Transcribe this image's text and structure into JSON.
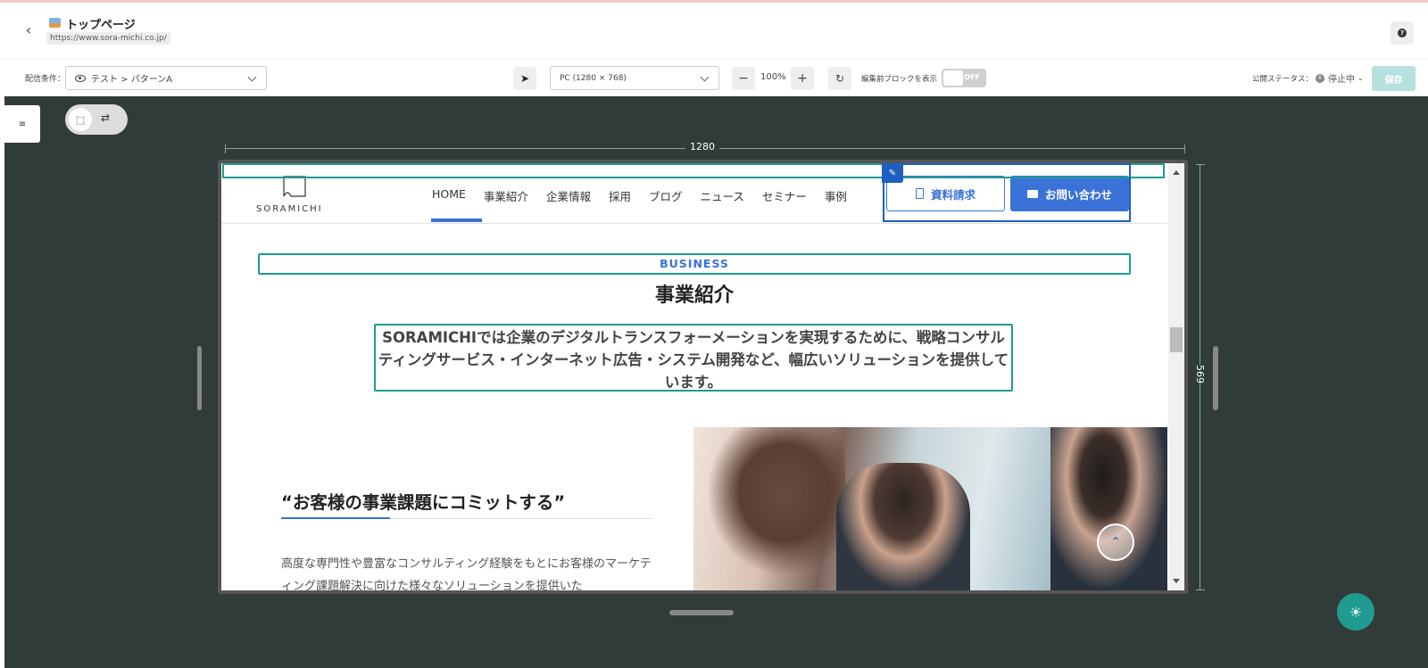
{
  "header": {
    "title": "トップページ",
    "url": "https://www.sora-michi.co.jp/"
  },
  "toolbar": {
    "condition_label": "配信条件：",
    "condition_value": "テスト > パターンA",
    "device": "PC (1280 × 768)",
    "zoom": "100%",
    "show_blocks_label": "編集前ブロックを表示",
    "toggle_state": "OFF",
    "status_label": "公開ステータス：",
    "status_value": "停止中",
    "save_label": "保存"
  },
  "canvas": {
    "width_label": "1280",
    "height_label": "569"
  },
  "site": {
    "logo": "SORAMICHI",
    "nav": [
      "HOME",
      "事業紹介",
      "企業情報",
      "採用",
      "ブログ",
      "ニュース",
      "セミナー",
      "事例"
    ],
    "btn_doc": "資料請求",
    "btn_contact": "お問い合わせ",
    "biz_eyebrow": "BUSINESS",
    "biz_title": "事業紹介",
    "biz_desc": "SORAMICHIでは企業のデジタルトランスフォーメーションを実現するために、戦略コンサルティングサービス・インターネット広告・システム開発など、幅広いソリューションを提供しています。",
    "quote_title": "“お客様の事業課題にコミットする”",
    "body_text": "高度な専門性や豊富なコンサルティング経験をもとにお客様のマーケティング課題解決に向けた様々なソリューションを提供いた"
  },
  "colors": {
    "accent": "#1f9c8f",
    "site_blue": "#3a72d8",
    "canvas_bg": "#313b3a"
  }
}
